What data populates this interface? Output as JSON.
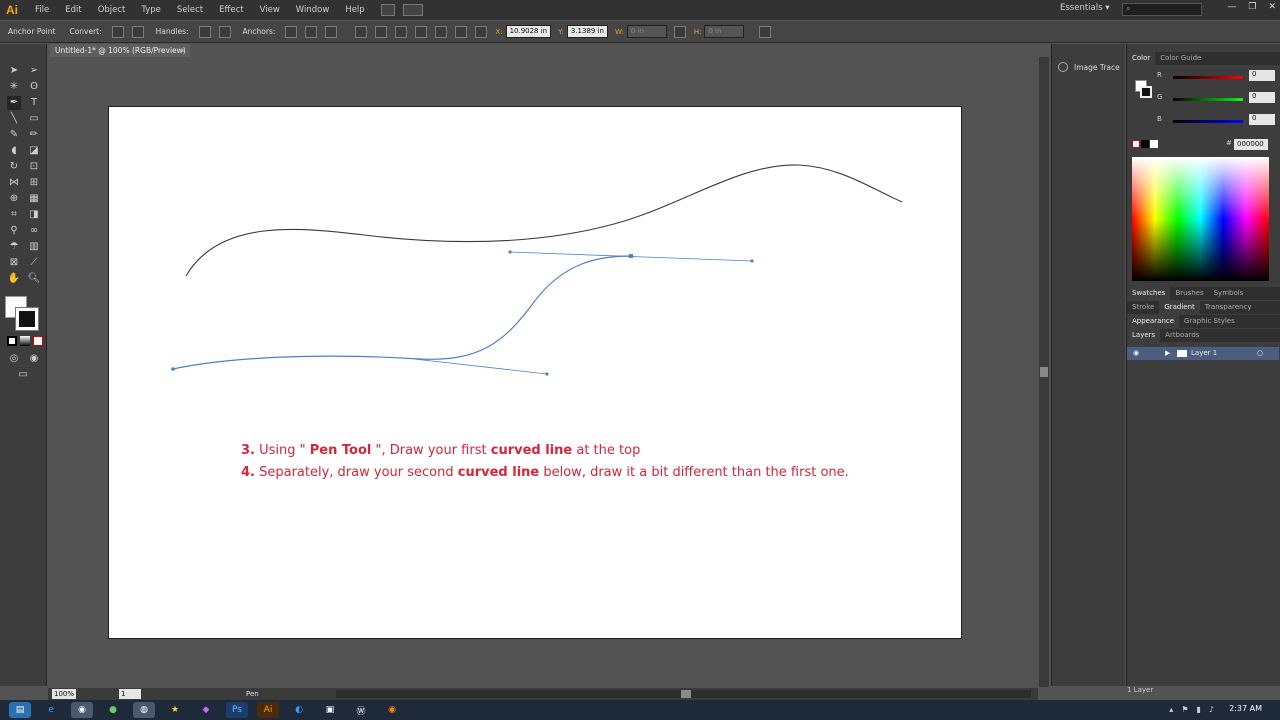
{
  "app": {
    "logo": "Ai"
  },
  "menu": {
    "items": [
      "File",
      "Edit",
      "Object",
      "Type",
      "Select",
      "Effect",
      "View",
      "Window",
      "Help"
    ],
    "workspace": "Essentials",
    "search_placeholder": ""
  },
  "controlbar": {
    "anchor_point": "Anchor Point",
    "convert": "Convert:",
    "handles": "Handles:",
    "anchors": "Anchors:",
    "x_label": "X:",
    "x_value": "10.9028 in",
    "y_label": "Y:",
    "y_value": "3.1389 in",
    "w_label": "W:",
    "w_value": "0 in",
    "h_label": "H:",
    "h_value": "0 in"
  },
  "document": {
    "tab_title": "Untitled-1* @ 100% (RGB/Preview)",
    "close": "×"
  },
  "instructions": {
    "line1": {
      "num": "3.",
      "pre": " Using \" ",
      "bold1": "Pen Tool",
      "mid": " \", Draw your first ",
      "bold2": "curved line",
      "post": " at the top"
    },
    "line2": {
      "num": "4.",
      "pre": " Separately, draw your second ",
      "bold1": "curved line",
      "post": " below, draw it a bit different than the first one."
    }
  },
  "panels": {
    "image_trace": "Image Trace",
    "color_tabs": [
      "Color",
      "Color Guide"
    ],
    "r_label": "R",
    "r_value": "0",
    "g_label": "G",
    "g_value": "0",
    "b_label": "B",
    "b_value": "0",
    "hex_label": "#",
    "hex_value": "000000",
    "tabs_row1": [
      "Swatches",
      "Brushes",
      "Symbols"
    ],
    "tabs_row2": [
      "Stroke",
      "Gradient",
      "Transparency"
    ],
    "tabs_row3": [
      "Appearance",
      "Graphic Styles"
    ],
    "tabs_row4": [
      "Layers",
      "Artboards"
    ],
    "layer_name": "Layer 1",
    "layers_count": "1 Layer"
  },
  "status": {
    "zoom": "100%",
    "page": "1",
    "tool": "Pen"
  },
  "taskbar": {
    "clock": "2:37 AM"
  },
  "colors": {
    "accent_red": "#d3273a",
    "panel": "#3d3d3d",
    "canvas_bg": "#535353",
    "path_blue": "#4f7fc2"
  }
}
